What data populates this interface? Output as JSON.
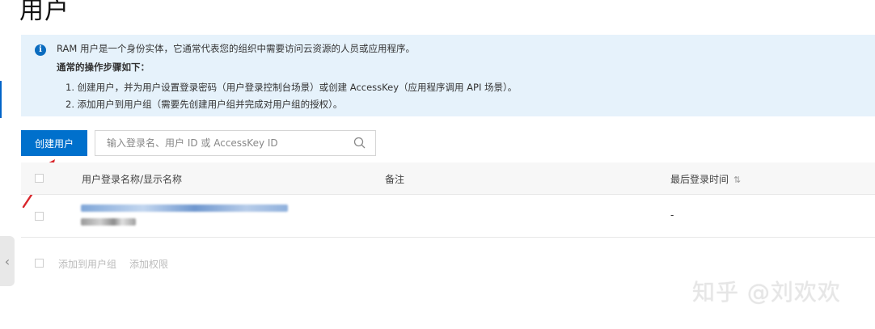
{
  "page": {
    "title": "用户"
  },
  "info": {
    "intro": "RAM 用户是一个身份实体，它通常代表您的组织中需要访问云资源的人员或应用程序。",
    "heading": "通常的操作步骤如下：",
    "steps": [
      "1. 创建用户，并为用户设置登录密码（用户登录控制台场景）或创建 AccessKey（应用程序调用 API 场景）。",
      "2. 添加用户到用户组（需要先创建用户组并完成对用户组的授权）。"
    ]
  },
  "toolbar": {
    "create_label": "创建用户",
    "search_placeholder": "输入登录名、用户 ID 或 AccessKey ID"
  },
  "table": {
    "columns": [
      "用户登录名称/显示名称",
      "备注",
      "最后登录时间"
    ],
    "rows": [
      {
        "last_login": "-"
      }
    ]
  },
  "bulk_actions": [
    "添加到用户组",
    "添加权限"
  ],
  "watermark": "知乎 @刘欢欢",
  "colors": {
    "primary": "#0070cc",
    "info_bg": "#e6f2fb",
    "arrow": "#d9262c"
  }
}
